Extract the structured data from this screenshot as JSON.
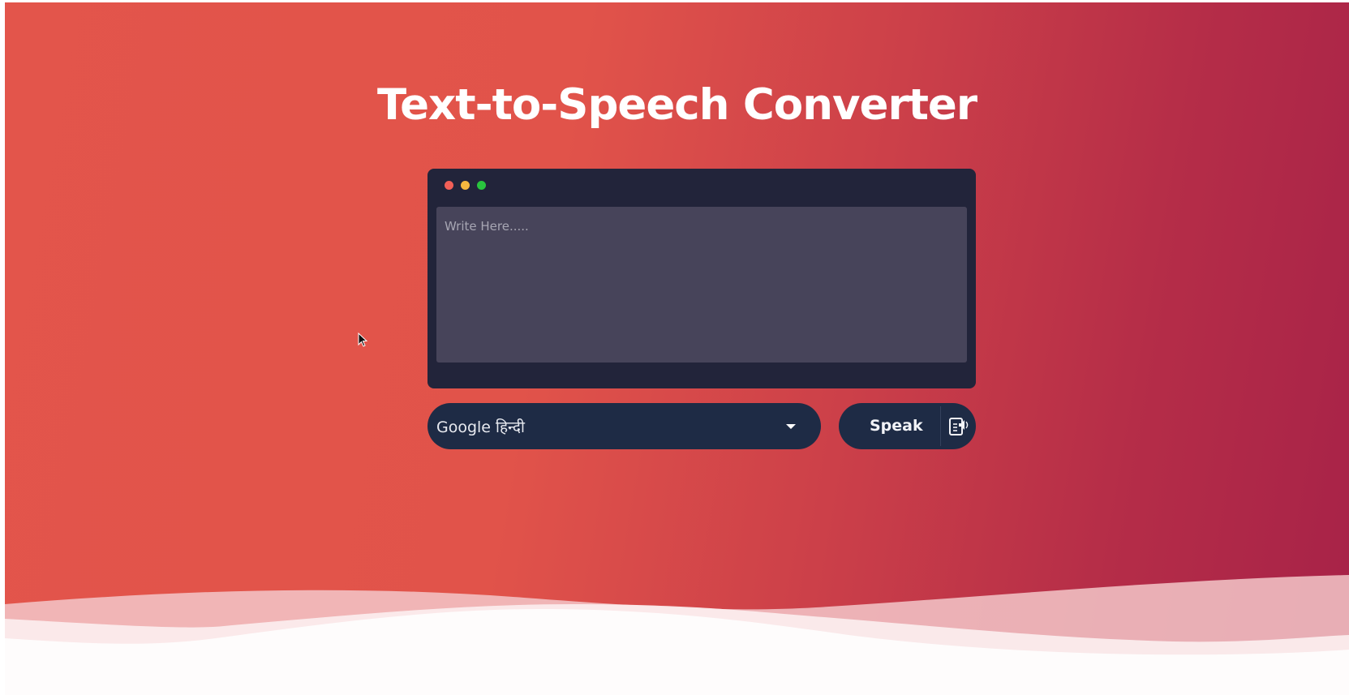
{
  "app": {
    "title": "Text-to-Speech Converter"
  },
  "editor": {
    "placeholder": "Write Here.....",
    "value": "",
    "window_dots": [
      "close-dot",
      "minimize-dot",
      "maximize-dot"
    ]
  },
  "voice_select": {
    "selected": "Google हिन्दी",
    "icon": "chevron-down-icon"
  },
  "speak_button": {
    "label": "Speak",
    "icon": "speaker-document-icon"
  },
  "colors": {
    "gradient_start": "#e3554b",
    "gradient_end": "#a72248",
    "editor_bg": "#22243a",
    "textarea_bg": "#47445a",
    "control_bg": "#1e2b45",
    "dot_red": "#f25f57",
    "dot_yellow": "#f6b83f",
    "dot_green": "#29c43e"
  }
}
